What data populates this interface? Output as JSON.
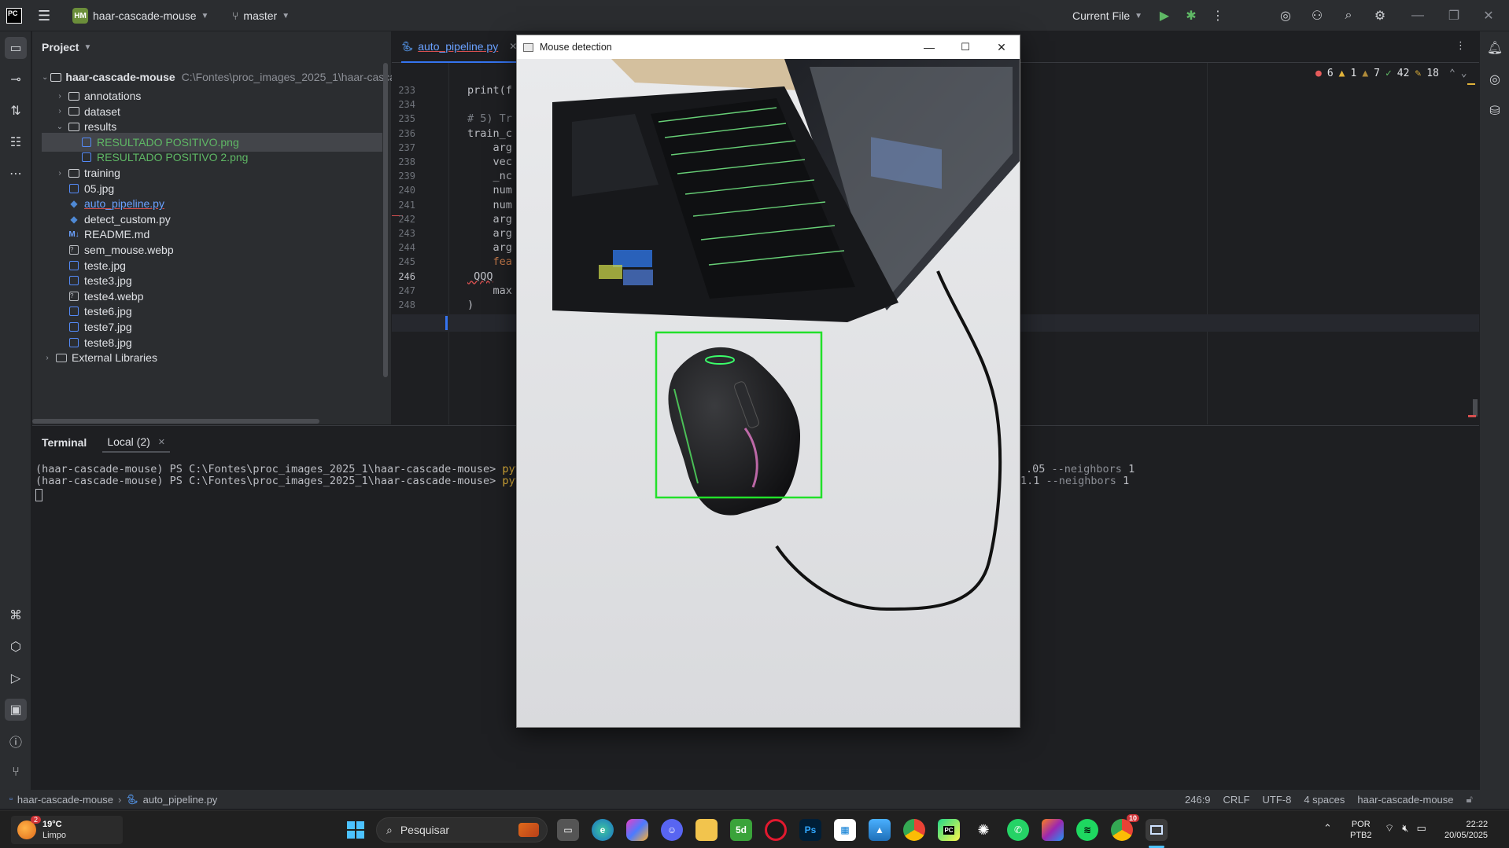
{
  "titlebar": {
    "app_logo": "PC",
    "project_badge": "HM",
    "project_name": "haar-cascade-mouse",
    "branch": "master",
    "run_config": "Current File"
  },
  "project_panel": {
    "title": "Project",
    "root_name": "haar-cascade-mouse",
    "root_path": "C:\\Fontes\\proc_images_2025_1\\haar-casca",
    "items": [
      {
        "label": "annotations",
        "type": "folder",
        "depth": 1,
        "expanded": false
      },
      {
        "label": "dataset",
        "type": "folder",
        "depth": 1,
        "expanded": false
      },
      {
        "label": "results",
        "type": "folder",
        "depth": 1,
        "expanded": true
      },
      {
        "label": "RESULTADO POSITIVO.png",
        "type": "image",
        "depth": 2,
        "selected": true,
        "color": "#5fb865"
      },
      {
        "label": "RESULTADO POSITIVO 2.png",
        "type": "image",
        "depth": 2,
        "color": "#5fb865"
      },
      {
        "label": "training",
        "type": "folder",
        "depth": 1,
        "expanded": false
      },
      {
        "label": "05.jpg",
        "type": "image",
        "depth": 1
      },
      {
        "label": "auto_pipeline.py",
        "type": "python",
        "depth": 1,
        "color": "#6aa1ff",
        "underline": true
      },
      {
        "label": "detect_custom.py",
        "type": "python",
        "depth": 1
      },
      {
        "label": "README.md",
        "type": "markdown",
        "depth": 1
      },
      {
        "label": "sem_mouse.webp",
        "type": "unknown",
        "depth": 1
      },
      {
        "label": "teste.jpg",
        "type": "image",
        "depth": 1
      },
      {
        "label": "teste3.jpg",
        "type": "image",
        "depth": 1
      },
      {
        "label": "teste4.webp",
        "type": "unknown",
        "depth": 1
      },
      {
        "label": "teste6.jpg",
        "type": "image",
        "depth": 1
      },
      {
        "label": "teste7.jpg",
        "type": "image",
        "depth": 1
      },
      {
        "label": "teste8.jpg",
        "type": "image",
        "depth": 1
      },
      {
        "label": "External Libraries",
        "type": "library",
        "depth": 0,
        "expanded": false
      }
    ]
  },
  "editor": {
    "tab_label": "auto_pipeline.py",
    "inspections": {
      "errors": "6",
      "warnings": "1",
      "weak_warnings": "7",
      "ok": "42",
      "typos": "18"
    },
    "lines": [
      {
        "num": "233",
        "code": "print(f"
      },
      {
        "num": "234",
        "code": ""
      },
      {
        "num": "235",
        "code": "# 5) Tr"
      },
      {
        "num": "236",
        "code": "train_c"
      },
      {
        "num": "237",
        "code": "    arg"
      },
      {
        "num": "238",
        "code": "    vec"
      },
      {
        "num": "239",
        "code": "    _nc"
      },
      {
        "num": "240",
        "code": "    num"
      },
      {
        "num": "241",
        "code": "    num"
      },
      {
        "num": "242",
        "code": "    arg"
      },
      {
        "num": "243",
        "code": "    arg"
      },
      {
        "num": "244",
        "code": "    arg"
      },
      {
        "num": "245",
        "code": "    fea"
      },
      {
        "num": "246",
        "code": " QQQ"
      },
      {
        "num": "247",
        "code": "    max"
      },
      {
        "num": "248",
        "code": ")"
      }
    ]
  },
  "terminal": {
    "tab_title": "Terminal",
    "session_tab": "Local (2)",
    "lines": [
      {
        "prompt": "(haar-cascade-mouse) PS C:\\Fontes\\proc_images_2025_1\\haar-cascade-mouse> ",
        "cmd_start": "pyth",
        "cmd_end_a": ".05",
        "cmd_end_b": " --neighbors ",
        "cmd_end_c": "1"
      },
      {
        "prompt": "(haar-cascade-mouse) PS C:\\Fontes\\proc_images_2025_1\\haar-cascade-mouse> ",
        "cmd_start": "pyth",
        "cmd_end_a": "1.1",
        "cmd_end_b": " --neighbors ",
        "cmd_end_c": "1"
      }
    ]
  },
  "detection_window": {
    "title": "Mouse detection"
  },
  "statusbar": {
    "crumb_project": "haar-cascade-mouse",
    "crumb_file": "auto_pipeline.py",
    "position": "246:9",
    "line_ending": "CRLF",
    "encoding": "UTF-8",
    "indent": "4 spaces",
    "interpreter": "haar-cascade-mouse"
  },
  "taskbar": {
    "weather_badge": "2",
    "weather_temp": "19°C",
    "weather_desc": "Limpo",
    "search_placeholder": "Pesquisar",
    "lang_top": "POR",
    "lang_bottom": "PTB2",
    "time": "22:22",
    "date": "20/05/2025",
    "chrome_badge": "10",
    "apps": [
      "start",
      "search",
      "task-view",
      "edge",
      "copilot",
      "discord",
      "file-explorer",
      "5d",
      "opera",
      "photoshop",
      "microsoft-store",
      "photos",
      "chrome",
      "pycharm",
      "chatgpt",
      "whatsapp",
      "jetbrains-toolbox",
      "spotify",
      "chrome-profile",
      "mouse-detection-window"
    ]
  },
  "colors": {
    "ide_bg": "#1e1f22",
    "panel_bg": "#2b2d30",
    "detection_box": "#22e02a",
    "vcs_added": "#5fb865",
    "link_blue": "#6aa1ff"
  }
}
